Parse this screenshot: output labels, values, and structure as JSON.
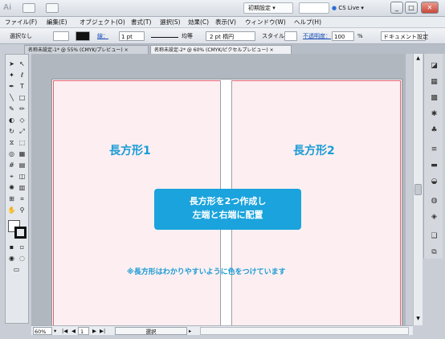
{
  "window": {
    "app_icon": "Ai",
    "workspace": "初期設定",
    "cs_live": "CS Live",
    "buttons": {
      "minimize": "_",
      "maximize": "□",
      "close": "✕"
    }
  },
  "menu": [
    "ファイル(F)",
    "編集(E)",
    "オブジェクト(O)",
    "書式(T)",
    "選択(S)",
    "効果(C)",
    "表示(V)",
    "ウィンドウ(W)",
    "ヘルプ(H)"
  ],
  "controlbar": {
    "selection": "選択なし",
    "stroke_label": "線：",
    "stroke_weight": "1 pt",
    "profile": "均等",
    "brush": "2 pt 楕円",
    "style_label": "スタイル：",
    "opacity_label": "不透明度：",
    "opacity_value": "100",
    "opacity_unit": "%",
    "doc_settings": "ドキュメント設定"
  },
  "tabs": [
    {
      "label": "名称未設定-1* @ 55% (CMYK/プレビュー)",
      "close": "×"
    },
    {
      "label": "名称未設定-2* @ 60% (CMYK/ピクセルプレビュー)",
      "close": "×"
    }
  ],
  "canvas": {
    "rect1_label": "長方形1",
    "rect2_label": "長方形2",
    "callout_line1": "長方形を2つ作成し",
    "callout_line2": "左端と右端に配置",
    "note": "※長方形はわかりやすいように色をつけています",
    "rect_fill": "#fdeff1",
    "rect_stroke": "#e06070",
    "accent": "#1aa3dc"
  },
  "statusbar": {
    "zoom": "60%",
    "artboard": "1",
    "tool": "選択"
  }
}
